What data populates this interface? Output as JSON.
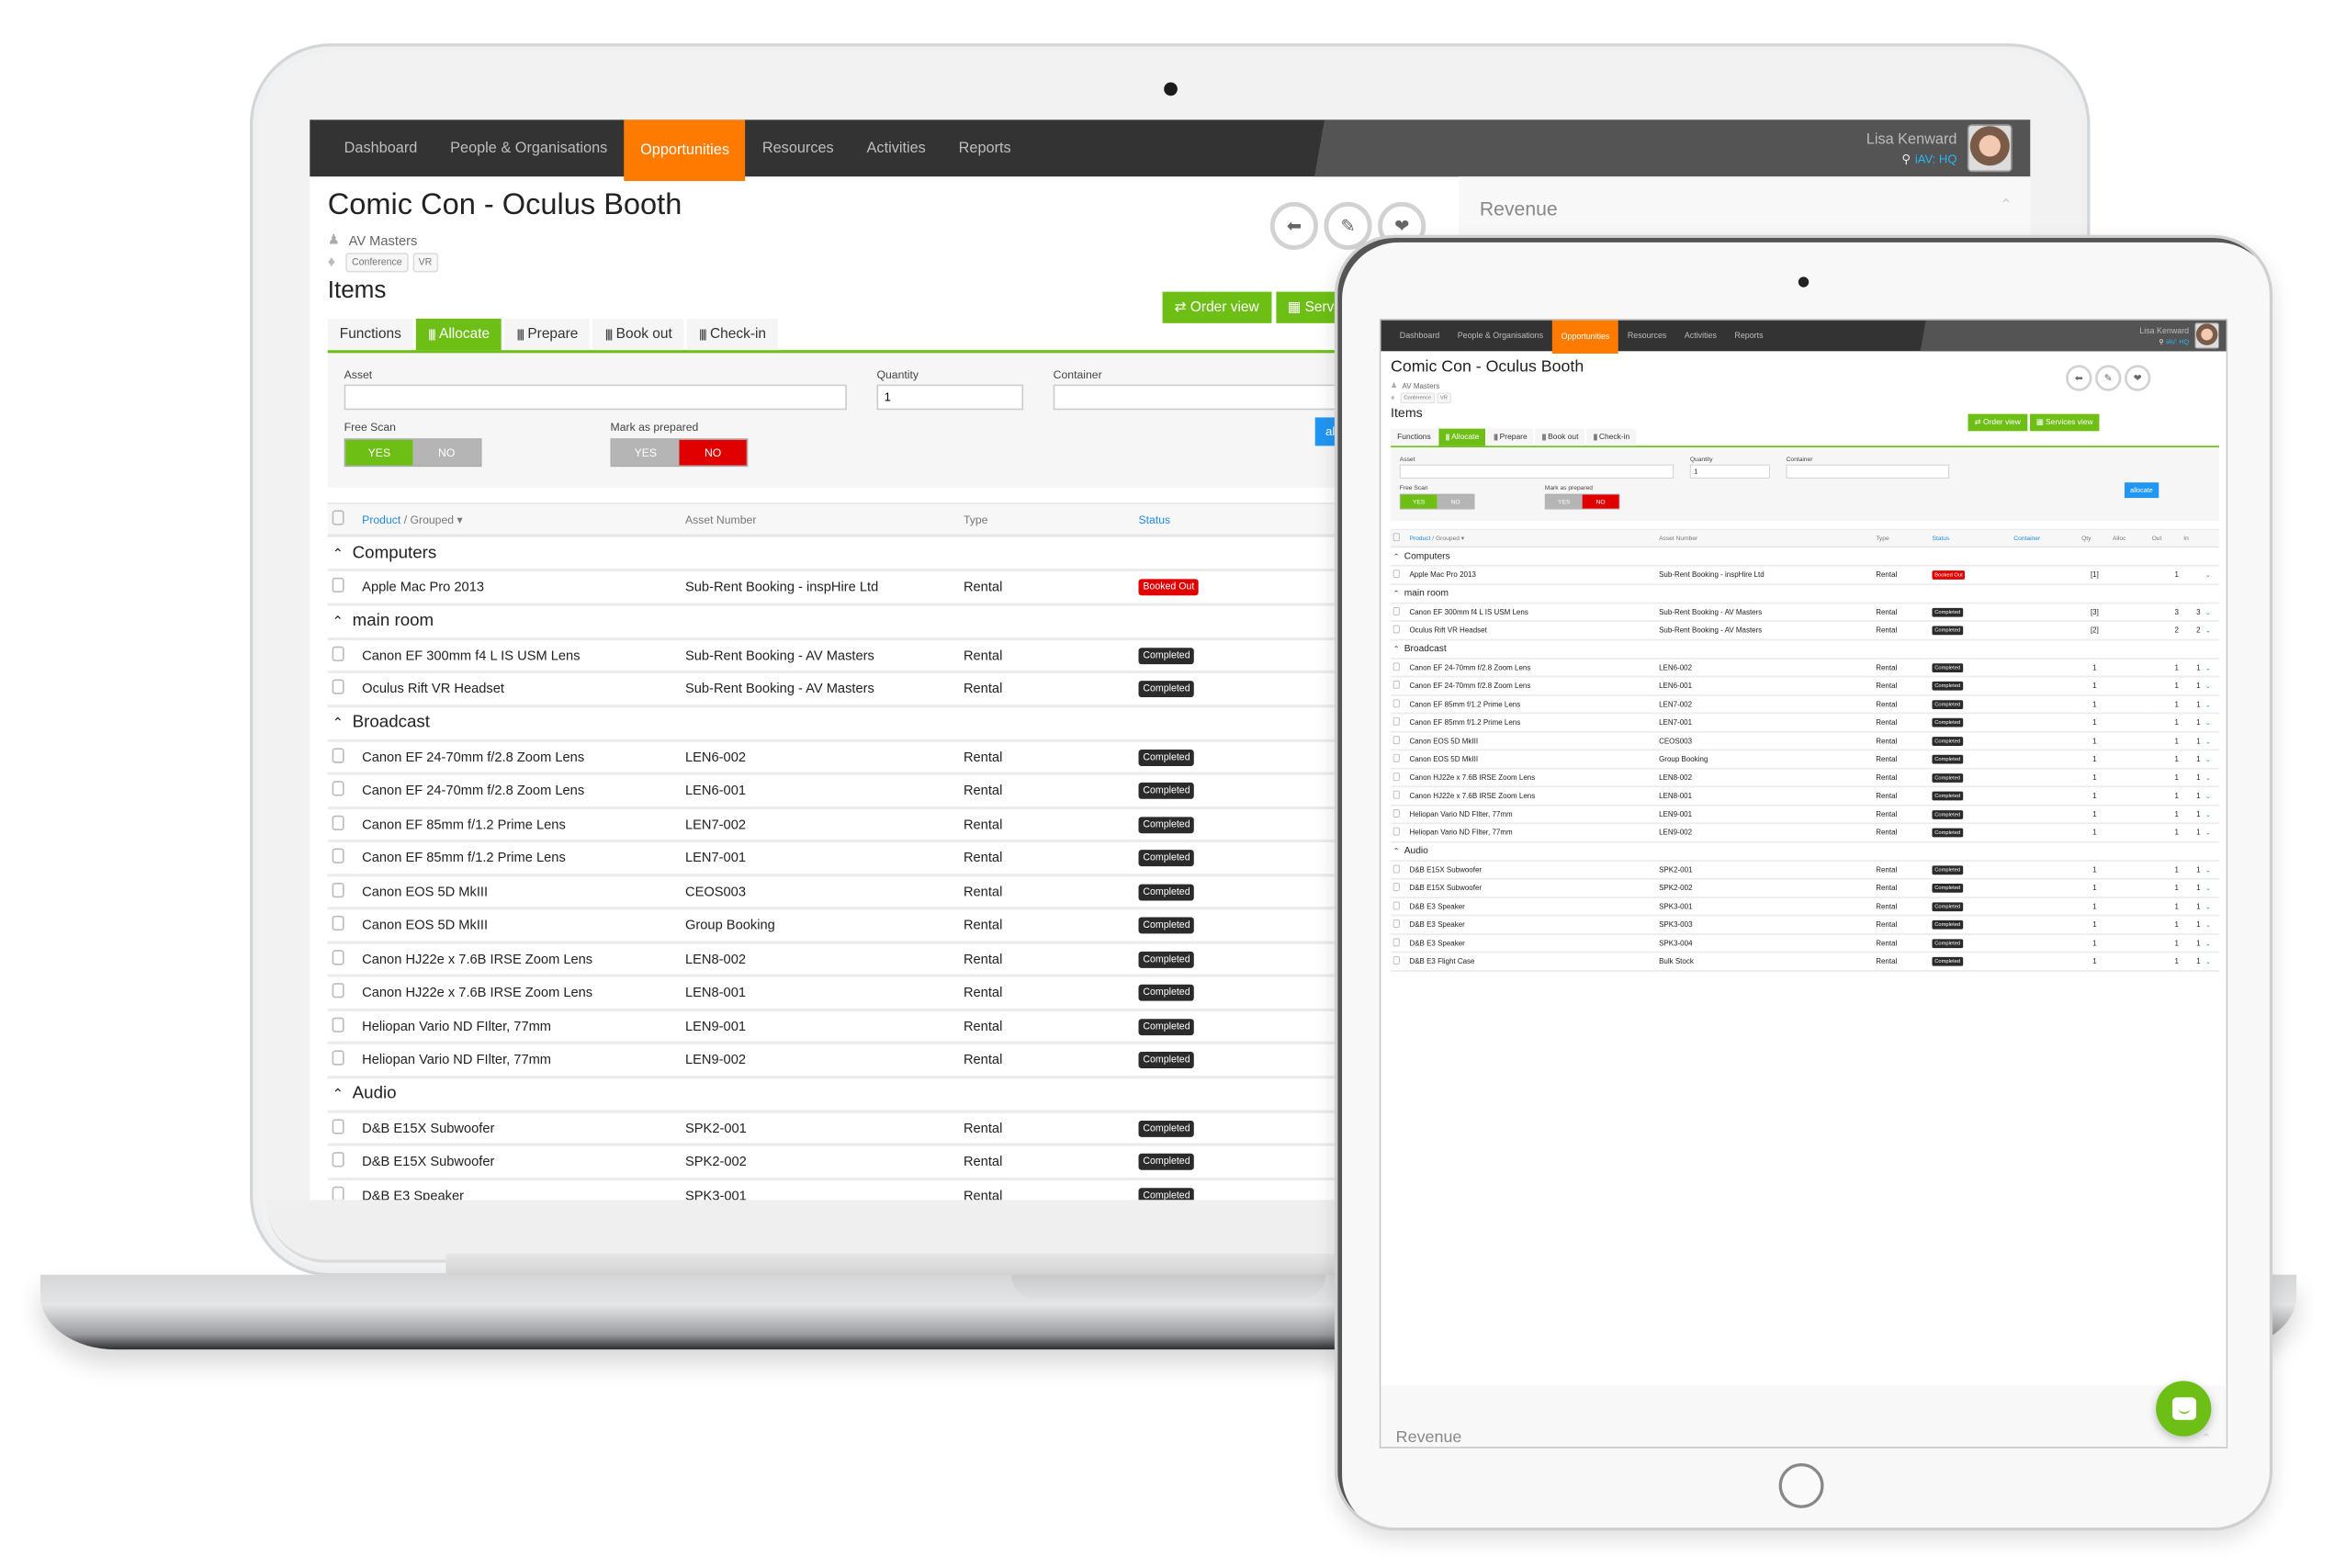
{
  "nav": {
    "items": [
      {
        "label": "Dashboard",
        "color": "#333333"
      },
      {
        "label": "People & Organisations",
        "color": "#b5179e"
      },
      {
        "label": "Opportunities",
        "color": "#ff7b00",
        "active": true
      },
      {
        "label": "Resources",
        "color": "#1eaadc"
      },
      {
        "label": "Activities",
        "color": "#6dbf16"
      },
      {
        "label": "Reports",
        "color": "#f5a623"
      }
    ],
    "strip_colors": [
      "#b5179e",
      "#e00000",
      "#ff7b00",
      "#1eaadc",
      "#6dbf16",
      "#f5a623"
    ],
    "user": {
      "name": "Lisa Kenward",
      "location": "iAV: HQ"
    }
  },
  "page": {
    "title": "Comic Con - Oculus Booth",
    "client": "AV Masters",
    "tags": [
      "Conference",
      "VR"
    ],
    "section": "Items",
    "actions": {
      "back": "back-arrow",
      "edit": "pencil",
      "favourite": "heart"
    },
    "buttons": {
      "order_view": "Order view",
      "services_view": "Services view"
    },
    "revenue_label": "Revenue"
  },
  "tabs": [
    {
      "label": "Functions",
      "barcode": false
    },
    {
      "label": "Allocate",
      "barcode": true,
      "active": true
    },
    {
      "label": "Prepare",
      "barcode": true
    },
    {
      "label": "Book out",
      "barcode": true
    },
    {
      "label": "Check-in",
      "barcode": true
    }
  ],
  "form": {
    "asset_label": "Asset",
    "asset_value": "",
    "quantity_label": "Quantity",
    "quantity_value": "1",
    "container_label": "Container",
    "container_value": "",
    "free_scan_label": "Free Scan",
    "free_scan": {
      "yes": "YES",
      "no": "NO",
      "selected": "YES"
    },
    "mark_prepared_label": "Mark as prepared",
    "mark_prepared": {
      "yes": "YES",
      "no": "NO",
      "selected": "NO"
    },
    "allocate_button": "allocate"
  },
  "table": {
    "columns": {
      "product": "Product",
      "sep": "/",
      "grouped": "Grouped ▾",
      "asset_number": "Asset Number",
      "type": "Type",
      "status": "Status",
      "container": "Container",
      "qty": "Qty",
      "alloc": "Alloc",
      "out": "Out",
      "in": "In"
    },
    "groups": [
      {
        "name": "Computers",
        "rows": [
          {
            "product": "Apple Mac Pro 2013",
            "asset": "Sub-Rent Booking - inspHire Ltd",
            "type": "Rental",
            "status": "Booked Out",
            "status_color": "#e00000",
            "qty": "[1]",
            "alloc": "",
            "out": "1",
            "in": "",
            "indent": false
          }
        ]
      },
      {
        "name": "main room",
        "rows": [
          {
            "product": "Canon EF 300mm f4 L IS USM Lens",
            "asset": "Sub-Rent Booking - AV Masters",
            "type": "Rental",
            "status": "Completed",
            "status_color": "#2b2b2b",
            "qty": "[3]",
            "alloc": "",
            "out": "3",
            "in": "3",
            "indent": false
          },
          {
            "product": "Oculus Rift VR Headset",
            "asset": "Sub-Rent Booking - AV Masters",
            "type": "Rental",
            "status": "Completed",
            "status_color": "#2b2b2b",
            "qty": "[2]",
            "alloc": "",
            "out": "2",
            "in": "2",
            "indent": false
          }
        ]
      },
      {
        "name": "Broadcast",
        "rows": [
          {
            "product": "Canon EF 24-70mm f/2.8 Zoom Lens",
            "asset": "LEN6-002",
            "type": "Rental",
            "status": "Completed",
            "status_color": "#2b2b2b",
            "qty": "1",
            "alloc": "",
            "out": "1",
            "in": "1",
            "indent": false
          },
          {
            "product": "Canon EF 24-70mm f/2.8 Zoom Lens",
            "asset": "LEN6-001",
            "type": "Rental",
            "status": "Completed",
            "status_color": "#2b2b2b",
            "qty": "1",
            "alloc": "",
            "out": "1",
            "in": "1",
            "indent": false
          },
          {
            "product": "Canon EF 85mm f/1.2 Prime Lens",
            "asset": "LEN7-002",
            "type": "Rental",
            "status": "Completed",
            "status_color": "#2b2b2b",
            "qty": "1",
            "alloc": "",
            "out": "1",
            "in": "1",
            "indent": false
          },
          {
            "product": "Canon EF 85mm f/1.2 Prime Lens",
            "asset": "LEN7-001",
            "type": "Rental",
            "status": "Completed",
            "status_color": "#2b2b2b",
            "qty": "1",
            "alloc": "",
            "out": "1",
            "in": "1",
            "indent": false
          },
          {
            "product": "Canon EOS 5D MkIII",
            "asset": "CEOS003",
            "type": "Rental",
            "status": "Completed",
            "status_color": "#2b2b2b",
            "qty": "1",
            "alloc": "",
            "out": "1",
            "in": "1",
            "indent": false
          },
          {
            "product": "Canon EOS 5D MkIII",
            "asset": "Group Booking",
            "type": "Rental",
            "status": "Completed",
            "status_color": "#2b2b2b",
            "qty": "1",
            "alloc": "",
            "out": "1",
            "in": "1",
            "indent": false
          },
          {
            "product": "Canon HJ22e x 7.6B IRSE Zoom Lens",
            "asset": "LEN8-002",
            "type": "Rental",
            "status": "Completed",
            "status_color": "#2b2b2b",
            "qty": "1",
            "alloc": "",
            "out": "1",
            "in": "1",
            "indent": false
          },
          {
            "product": "Canon HJ22e x 7.6B IRSE Zoom Lens",
            "asset": "LEN8-001",
            "type": "Rental",
            "status": "Completed",
            "status_color": "#2b2b2b",
            "qty": "1",
            "alloc": "",
            "out": "1",
            "in": "1",
            "indent": false
          },
          {
            "product": "Heliopan Vario ND FIlter, 77mm",
            "asset": "LEN9-001",
            "type": "Rental",
            "status": "Completed",
            "status_color": "#2b2b2b",
            "qty": "1",
            "alloc": "",
            "out": "1",
            "in": "1",
            "indent": true
          },
          {
            "product": "Heliopan Vario ND FIlter, 77mm",
            "asset": "LEN9-002",
            "type": "Rental",
            "status": "Completed",
            "status_color": "#2b2b2b",
            "qty": "1",
            "alloc": "",
            "out": "1",
            "in": "1",
            "indent": true
          }
        ]
      },
      {
        "name": "Audio",
        "rows": [
          {
            "product": "D&B E15X Subwoofer",
            "asset": "SPK2-001",
            "type": "Rental",
            "status": "Completed",
            "status_color": "#2b2b2b",
            "qty": "1",
            "alloc": "",
            "out": "1",
            "in": "1",
            "indent": false
          },
          {
            "product": "D&B E15X Subwoofer",
            "asset": "SPK2-002",
            "type": "Rental",
            "status": "Completed",
            "status_color": "#2b2b2b",
            "qty": "1",
            "alloc": "",
            "out": "1",
            "in": "1",
            "indent": false
          },
          {
            "product": "D&B E3 Speaker",
            "asset": "SPK3-001",
            "type": "Rental",
            "status": "Completed",
            "status_color": "#2b2b2b",
            "qty": "1",
            "alloc": "",
            "out": "1",
            "in": "1",
            "indent": false
          },
          {
            "product": "D&B E3 Speaker",
            "asset": "SPK3-003",
            "type": "Rental",
            "status": "Completed",
            "status_color": "#2b2b2b",
            "qty": "1",
            "alloc": "",
            "out": "1",
            "in": "1",
            "indent": false
          },
          {
            "product": "D&B E3 Speaker",
            "asset": "SPK3-004",
            "type": "Rental",
            "status": "Completed",
            "status_color": "#2b2b2b",
            "qty": "1",
            "alloc": "",
            "out": "1",
            "in": "1",
            "indent": false
          },
          {
            "product": "D&B E3 Flight Case",
            "asset": "Bulk Stock",
            "type": "Rental",
            "status": "Completed",
            "status_color": "#2b2b2b",
            "qty": "1",
            "alloc": "",
            "out": "1",
            "in": "1",
            "indent": true
          }
        ]
      }
    ]
  },
  "colors": {
    "brand_green": "#6dbf16",
    "nav_active": "#ff7b00",
    "link_blue": "#1e88e5",
    "allocate_blue": "#2196f3",
    "danger_red": "#e00000"
  }
}
